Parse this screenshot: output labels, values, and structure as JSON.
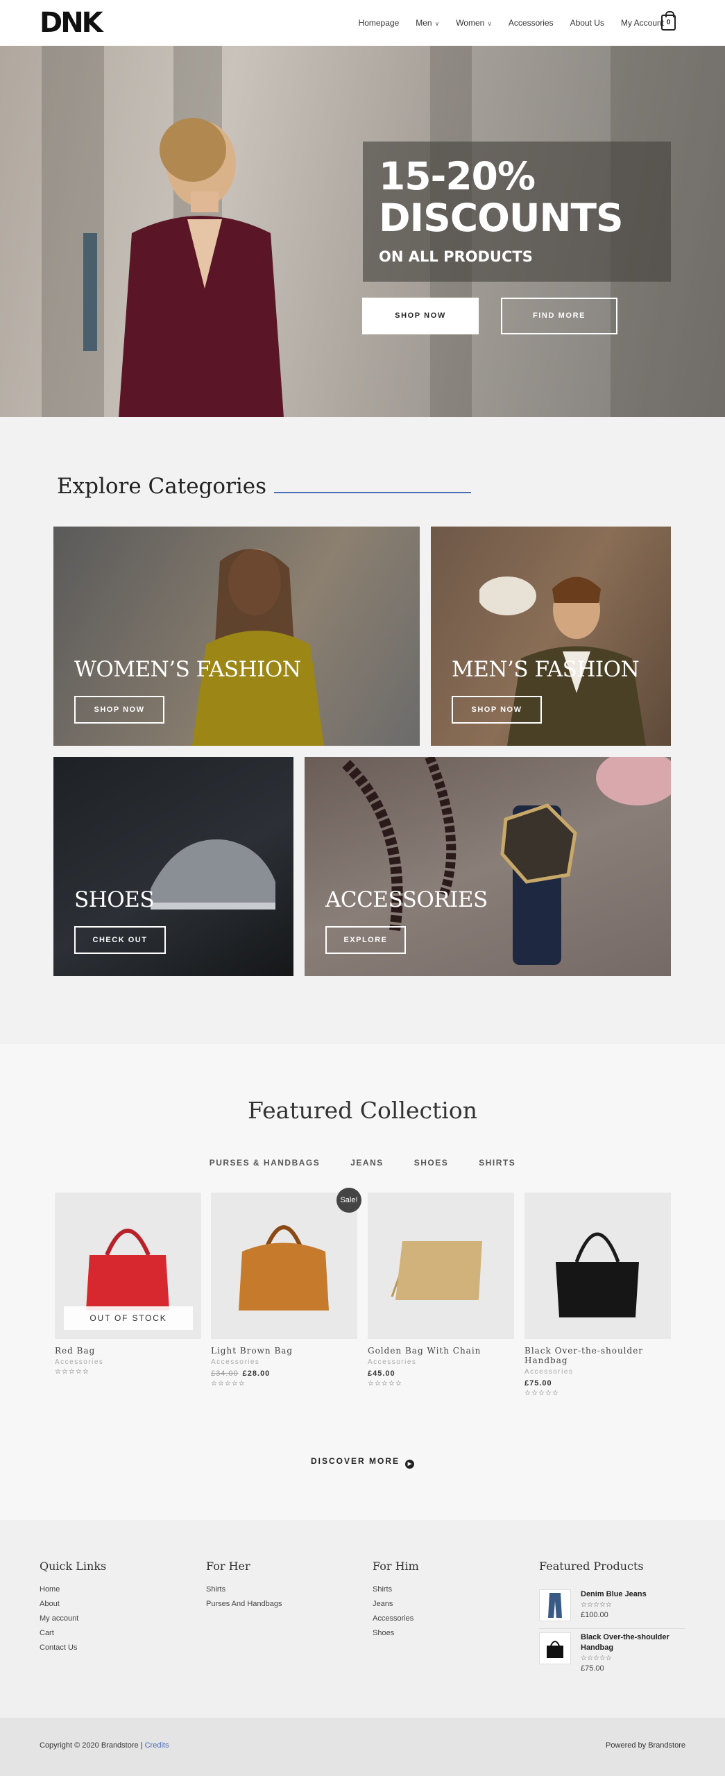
{
  "header": {
    "logo": "DNK",
    "nav": [
      "Homepage",
      "Men",
      "Women",
      "Accessories",
      "About Us",
      "My Account"
    ],
    "cart_count": "0"
  },
  "hero": {
    "title_line1": "15-20%",
    "title_line2": "DISCOUNTS",
    "subtitle": "ON ALL PRODUCTS",
    "btn_shop": "SHOP NOW",
    "btn_find": "FIND MORE"
  },
  "categories": {
    "title": "Explore Categories",
    "tiles": [
      {
        "name": "WOMEN’S FASHION",
        "button": "SHOP NOW"
      },
      {
        "name": "MEN’S FASHION",
        "button": "SHOP NOW"
      },
      {
        "name": "SHOES",
        "button": "CHECK OUT"
      },
      {
        "name": "ACCESSORIES",
        "button": "EXPLORE"
      }
    ]
  },
  "featured": {
    "title": "Featured Collection",
    "filters": [
      "PURSES & HANDBAGS",
      "JEANS",
      "SHOES",
      "SHIRTS"
    ],
    "sale_badge": "Sale!",
    "out_of_stock": "OUT OF STOCK",
    "products": [
      {
        "name": "Red Bag",
        "category": "Accessories",
        "price": "",
        "old_price": "",
        "rating": "☆☆☆☆☆"
      },
      {
        "name": "Light Brown Bag",
        "category": "Accessories",
        "price": "£28.00",
        "old_price": "£34.00",
        "rating": "☆☆☆☆☆"
      },
      {
        "name": "Golden Bag With Chain",
        "category": "Accessories",
        "price": "£45.00",
        "old_price": "",
        "rating": "☆☆☆☆☆"
      },
      {
        "name": "Black Over-the-shoulder Handbag",
        "category": "Accessories",
        "price": "£75.00",
        "old_price": "",
        "rating": "☆☆☆☆☆"
      }
    ],
    "discover": "DISCOVER MORE"
  },
  "footer": {
    "quick_links": {
      "title": "Quick Links",
      "items": [
        "Home",
        "About",
        "My account",
        "Cart",
        "Contact Us"
      ]
    },
    "for_her": {
      "title": "For Her",
      "items": [
        "Shirts",
        "Purses And Handbags"
      ]
    },
    "for_him": {
      "title": "For Him",
      "items": [
        "Shirts",
        "Jeans",
        "Accessories",
        "Shoes"
      ]
    },
    "featured_products": {
      "title": "Featured Products",
      "items": [
        {
          "name": "Denim Blue Jeans",
          "rating": "☆☆☆☆☆",
          "price": "£100.00"
        },
        {
          "name": "Black Over-the-shoulder Handbag",
          "rating": "☆☆☆☆☆",
          "price": "£75.00"
        }
      ]
    },
    "copyright": "Copyright © 2020 Brandstore | ",
    "credits": "Credits",
    "powered": "Powered by Brandstore"
  }
}
